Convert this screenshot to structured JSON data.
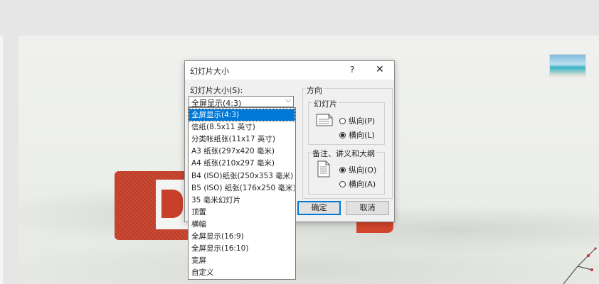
{
  "dialog": {
    "title": "幻灯片大小",
    "help_label": "?",
    "close_label": "✕",
    "size_label": "幻灯片大小(S):",
    "size_value": "全屏显示(4:3)",
    "orientation_title": "方向",
    "slides_group": {
      "title": "幻灯片",
      "portrait_label": "纵向(P)",
      "landscape_label": "横向(L)",
      "selected": "landscape"
    },
    "notes_group": {
      "title": "备注、讲义和大纲",
      "portrait_label": "纵向(O)",
      "landscape_label": "横向(A)",
      "selected": "portrait"
    },
    "ok_label": "确定",
    "cancel_label": "取消"
  },
  "dropdown": {
    "options": [
      "全屏显示(4:3)",
      "信纸(8.5x11 英寸)",
      "分类帐纸张(11x17 英寸)",
      "A3 纸张(297x420 毫米)",
      "A4 纸张(210x297 毫米)",
      "B4 (ISO)纸张(250x353 毫米)",
      "B5 (ISO) 纸张(176x250 毫米)",
      "35 毫米幻灯片",
      "顶置",
      "横幅",
      "全屏显示(16:9)",
      "全屏显示(16:10)",
      "宽屏",
      "自定义"
    ],
    "selected_index": 0
  },
  "icons": {
    "help": "help-icon",
    "close": "close-icon",
    "chevron": "chevron-down-icon",
    "page": "page-icon"
  },
  "colors": {
    "accent": "#0078d7",
    "ppt_red": "#c7402a"
  }
}
